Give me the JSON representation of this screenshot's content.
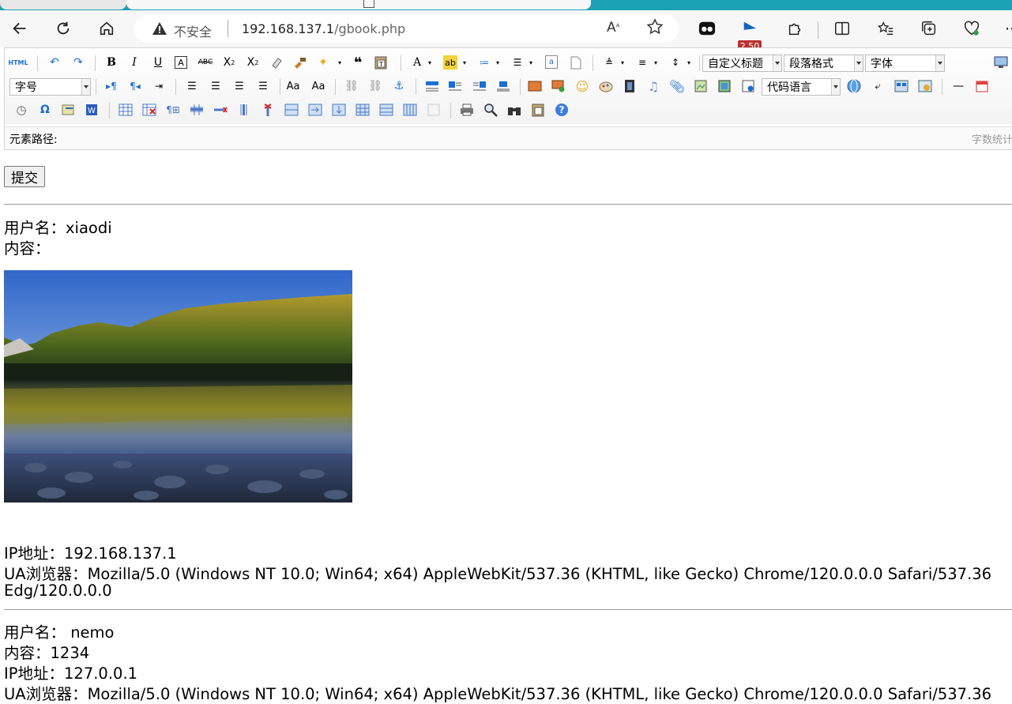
{
  "browser": {
    "insecure_label": "不安全",
    "url_host": "192.168.137.1",
    "url_path": "/gbook.php",
    "badge": "2.50",
    "read_aloud_label": "Aᴾ"
  },
  "editor": {
    "combos": {
      "custom_heading": "自定义标题",
      "paragraph_format": "段落格式",
      "font_family": "字体",
      "font_size": "字号",
      "code_language": "代码语言"
    },
    "element_path_label": "元素路径:",
    "word_count_label": "字数统计"
  },
  "form": {
    "submit_label": "提交"
  },
  "entries": [
    {
      "username_line": "用户名：xiaodi",
      "content_line": "内容：",
      "ip_line": "IP地址：192.168.137.1",
      "ua_line_1": "UA浏览器：Mozilla/5.0 (Windows NT 10.0; Win64; x64) AppleWebKit/537.36 (KHTML, like Gecko) Chrome/120.0.0.0 Safari/537.36",
      "ua_line_2": "Edg/120.0.0.0"
    },
    {
      "username_line": "用户名： nemo",
      "content_line": "内容：1234",
      "ip_line": "IP地址：127.0.0.1",
      "ua_line_1": "UA浏览器：Mozilla/5.0 (Windows NT 10.0; Win64; x64) AppleWebKit/537.36 (KHTML, like Gecko) Chrome/120.0.0.0 Safari/537.36"
    }
  ],
  "colors": {
    "tab_strip": "#1aa1b4",
    "chrome_bg": "#f7f7f7",
    "link_blue": "#1a6fd1"
  }
}
